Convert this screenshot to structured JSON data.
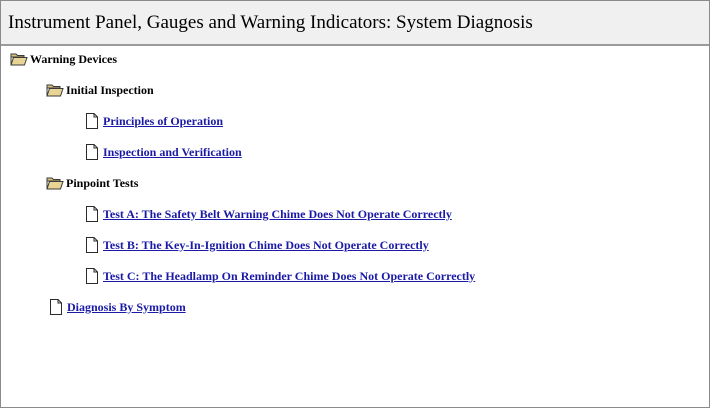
{
  "window": {
    "title": "Instrument Panel, Gauges and Warning Indicators:  System Diagnosis"
  },
  "tree": {
    "root": {
      "label": "Warning Devices",
      "icon": "open-folder-icon"
    },
    "initial_inspection": {
      "label": "Initial Inspection",
      "icon": "open-folder-icon",
      "items": [
        {
          "label": "Principles of Operation",
          "icon": "document-icon"
        },
        {
          "label": "Inspection and Verification",
          "icon": "document-icon"
        }
      ]
    },
    "pinpoint_tests": {
      "label": "Pinpoint Tests",
      "icon": "open-folder-icon",
      "items": [
        {
          "label": "Test A: The Safety Belt Warning Chime Does Not Operate Correctly",
          "icon": "document-icon"
        },
        {
          "label": "Test B: The Key-In-Ignition Chime Does Not Operate Correctly",
          "icon": "document-icon"
        },
        {
          "label": "Test C: The Headlamp On Reminder Chime Does Not Operate Correctly",
          "icon": "document-icon"
        }
      ]
    },
    "diagnosis_by_symptom": {
      "label": "Diagnosis By Symptom",
      "icon": "document-icon"
    }
  },
  "colors": {
    "link": "#1a1aa6",
    "title_bar_bg": "#f0f0f0",
    "folder_fill": "#d9c27a"
  }
}
